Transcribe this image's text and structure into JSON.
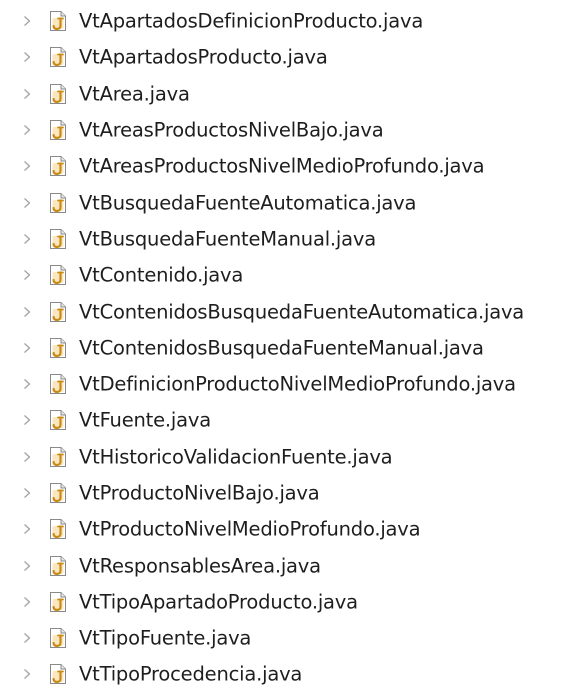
{
  "colors": {
    "text": "#1e1e1e",
    "expander": "#a6a6a6",
    "icon_page": "#ffffff",
    "icon_border": "#8a8a8a",
    "icon_j": "#c98b16",
    "icon_j_bg": "#f5d48c"
  },
  "icons": {
    "expander": "chevron-right-icon",
    "file": "java-source-file-icon"
  },
  "files": [
    "VtApartadosDefinicionProducto.java",
    "VtApartadosProducto.java",
    "VtArea.java",
    "VtAreasProductosNivelBajo.java",
    "VtAreasProductosNivelMedioProfundo.java",
    "VtBusquedaFuenteAutomatica.java",
    "VtBusquedaFuenteManual.java",
    "VtContenido.java",
    "VtContenidosBusquedaFuenteAutomatica.java",
    "VtContenidosBusquedaFuenteManual.java",
    "VtDefinicionProductoNivelMedioProfundo.java",
    "VtFuente.java",
    "VtHistoricoValidacionFuente.java",
    "VtProductoNivelBajo.java",
    "VtProductoNivelMedioProfundo.java",
    "VtResponsablesArea.java",
    "VtTipoApartadoProducto.java",
    "VtTipoFuente.java",
    "VtTipoProcedencia.java"
  ]
}
